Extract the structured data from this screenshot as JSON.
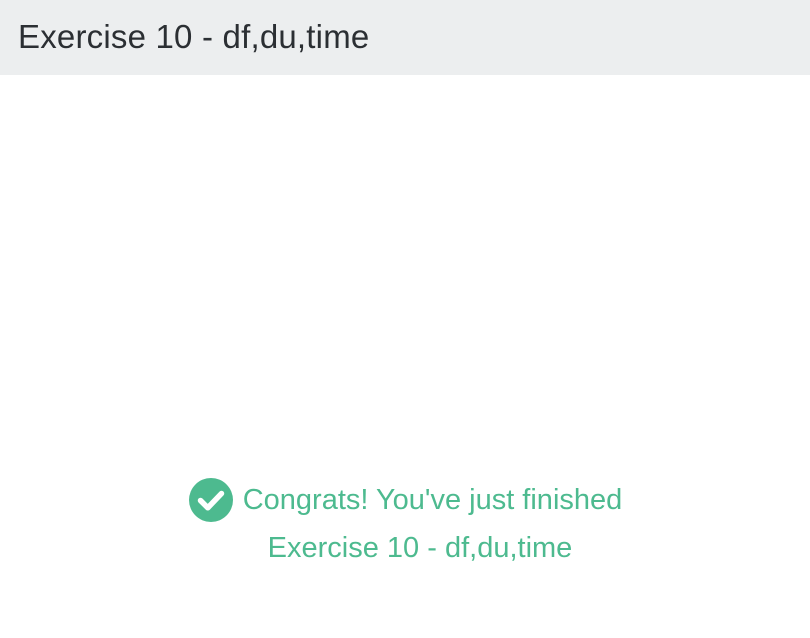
{
  "header": {
    "title": "Exercise 10 - df,du,time"
  },
  "completion": {
    "message_line1": "Congrats! You've just finished",
    "message_line2": "Exercise 10 - df,du,time",
    "icon": "check-circle-icon",
    "accent_color": "#4dba8f"
  }
}
